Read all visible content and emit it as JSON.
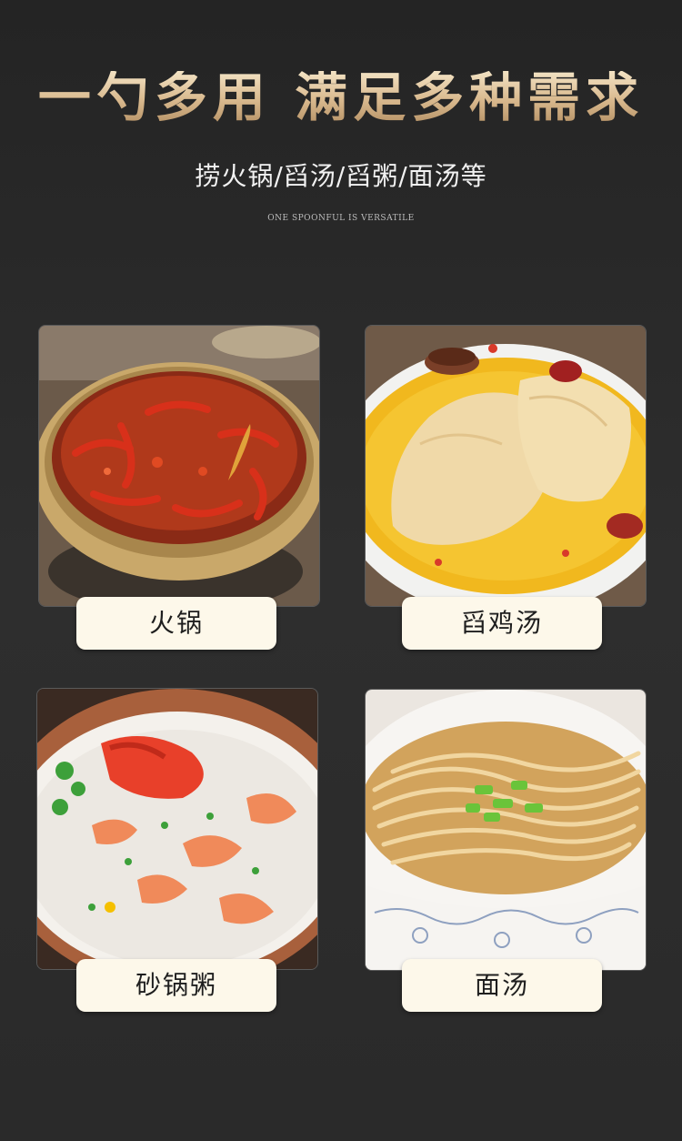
{
  "header": {
    "title": "一勺多用  满足多种需求",
    "subtitle": "捞火锅/舀汤/舀粥/面汤等",
    "caption_en": "ONE SPOONFUL IS VERSATILE"
  },
  "uses": [
    {
      "label": "火锅",
      "image_icon": "hotpot-image"
    },
    {
      "label": "舀鸡汤",
      "image_icon": "chicken-soup-image"
    },
    {
      "label": "砂锅粥",
      "image_icon": "seafood-congee-image"
    },
    {
      "label": "面汤",
      "image_icon": "noodle-soup-image"
    }
  ],
  "colors": {
    "background": "#2b2b2b",
    "title_gold": "#e6cda8",
    "label_bg": "#fdf8ea"
  }
}
